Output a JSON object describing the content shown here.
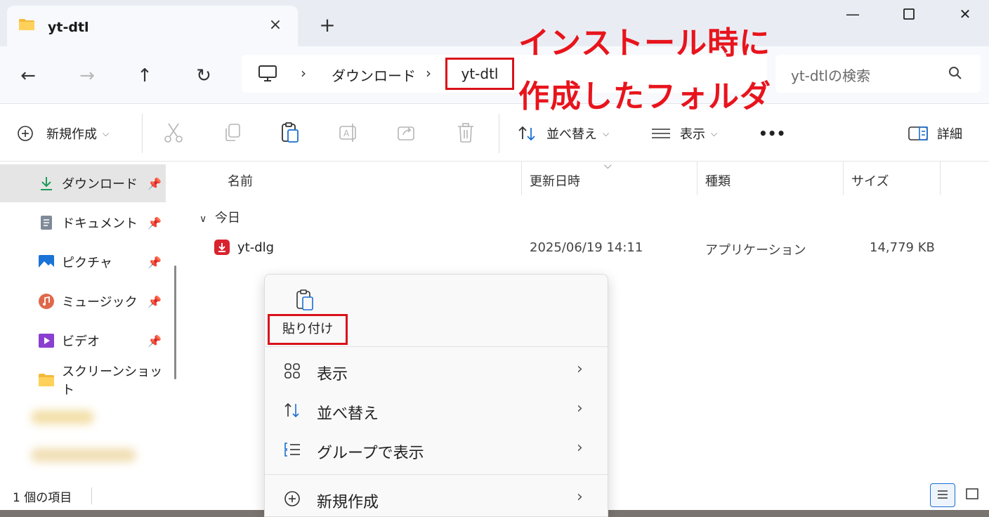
{
  "window": {
    "tab_title": "yt-dtl",
    "new_tab": "+",
    "close_tab": "×",
    "minimize": "—",
    "close": "✕"
  },
  "nav": {
    "back": "←",
    "forward": "→",
    "up": "↑",
    "refresh": "↻",
    "breadcrumb": [
      "ダウンロード",
      "yt-dtl"
    ],
    "separator": "›",
    "search_placeholder": "yt-dtlの検索"
  },
  "annotation": {
    "line1": "インストール時に",
    "line2": "作成したフォルダ",
    "color": "#e8141c"
  },
  "toolbar": {
    "new_label": "新規作成",
    "sort_label": "並べ替え",
    "view_label": "表示",
    "more_label": "•••",
    "details_label": "詳細"
  },
  "sidebar": {
    "items": [
      {
        "label": "ダウンロード",
        "icon": "download-icon",
        "pinned": true
      },
      {
        "label": "ドキュメント",
        "icon": "document-icon",
        "pinned": true
      },
      {
        "label": "ピクチャ",
        "icon": "pictures-icon",
        "pinned": true
      },
      {
        "label": "ミュージック",
        "icon": "music-icon",
        "pinned": true
      },
      {
        "label": "ビデオ",
        "icon": "video-icon",
        "pinned": true
      },
      {
        "label": "スクリーンショット",
        "icon": "folder-icon",
        "pinned": false
      }
    ]
  },
  "filelist": {
    "columns": {
      "name": "名前",
      "modified": "更新日時",
      "type": "種類",
      "size": "サイズ"
    },
    "group": "今日",
    "group_chevron": "∨",
    "rows": [
      {
        "name": "yt-dlg",
        "modified": "2025/06/19 14:11",
        "type": "アプリケーション",
        "size": "14,779 KB"
      }
    ]
  },
  "status": {
    "item_count": "1 個の項目"
  },
  "context_menu": {
    "paste_label": "貼り付け",
    "items": [
      {
        "label": "表示",
        "icon": "grid-view-icon"
      },
      {
        "label": "並べ替え",
        "icon": "sort-icon"
      },
      {
        "label": "グループで表示",
        "icon": "group-icon"
      },
      {
        "label": "新規作成",
        "icon": "plus-circle-icon"
      }
    ],
    "submenu_arrow": "›"
  }
}
